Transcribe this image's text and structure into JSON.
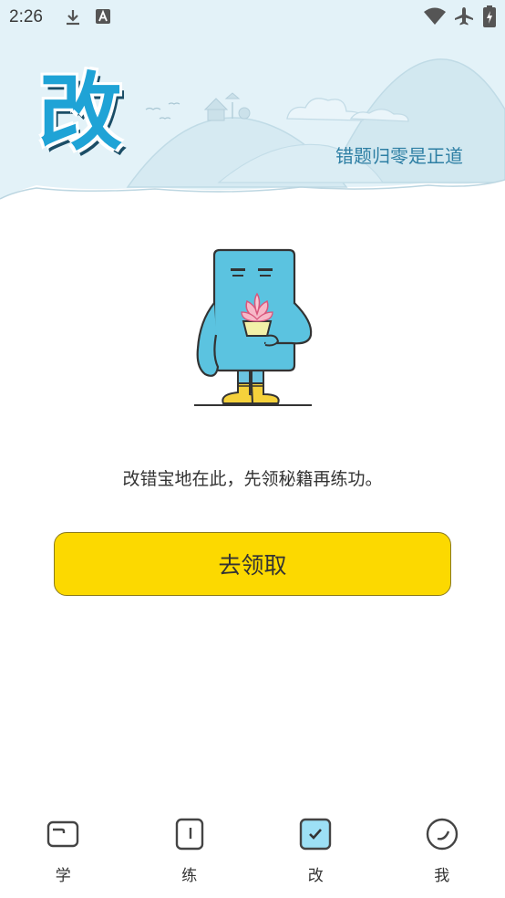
{
  "status_bar": {
    "time": "2:26",
    "icons": [
      "download-icon",
      "font-a-icon",
      "wifi-icon",
      "airplane-icon",
      "battery-charging-icon"
    ]
  },
  "header": {
    "big_char": "改",
    "slogan": "错题归零是正道",
    "colors": {
      "sky": "#e2f1f7",
      "accent": "#1fa3d6",
      "hill": "#d3e7ef"
    }
  },
  "main": {
    "message": "改错宝地在此，先领秘籍再练功。",
    "button_label": "去领取",
    "button_color": "#fcd900"
  },
  "bottom_nav": {
    "items": [
      {
        "label": "学",
        "icon": "book-icon",
        "active": false
      },
      {
        "label": "练",
        "icon": "practice-icon",
        "active": false
      },
      {
        "label": "改",
        "icon": "check-box-icon",
        "active": true
      },
      {
        "label": "我",
        "icon": "clock-icon",
        "active": false
      }
    ],
    "active_color": "#9de0f5"
  }
}
